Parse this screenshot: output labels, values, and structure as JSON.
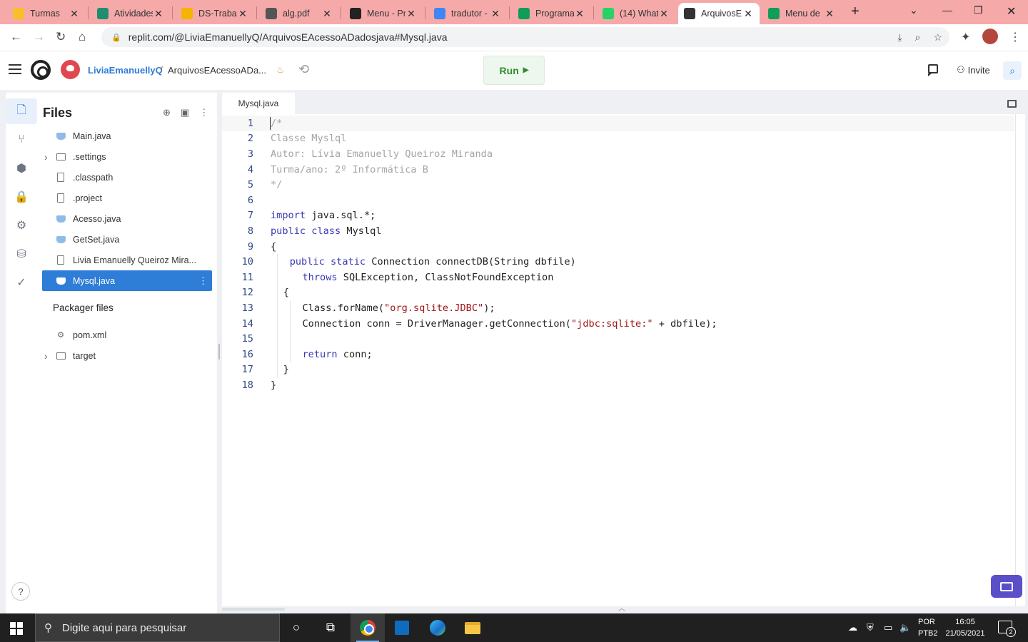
{
  "browser": {
    "tabs": [
      {
        "title": "Turmas",
        "icon": "classroom-icon",
        "color": "#f9bf2b"
      },
      {
        "title": "Atividades",
        "icon": "classroom-assignment-icon",
        "color": "#1e8e6e"
      },
      {
        "title": "DS-Trabal",
        "icon": "drive-icon",
        "color": "#f4b400"
      },
      {
        "title": "alg.pdf",
        "icon": "pdf-icon",
        "color": "#555555"
      },
      {
        "title": "Menu - Pr",
        "icon": "github-icon",
        "color": "#222222"
      },
      {
        "title": "tradutor -",
        "icon": "google-icon",
        "color": "#4285f4"
      },
      {
        "title": "Programa",
        "icon": "drive-icon",
        "color": "#0f9d58"
      },
      {
        "title": "(14) What",
        "icon": "whatsapp-icon",
        "color": "#25d366"
      },
      {
        "title": "ArquivosE",
        "icon": "replit-icon",
        "color": "#333333",
        "active": true
      },
      {
        "title": "Menu de",
        "icon": "sheets-icon",
        "color": "#0f9d58"
      }
    ],
    "url": "replit.com/@LiviaEmanuellyQ/ArquivosEAcessoADadosjava#Mysql.java"
  },
  "header": {
    "username": "LiviaEmanuellyQ",
    "separator": "/",
    "repl_name": "ArquivosEAcessoADa...",
    "run_label": "Run",
    "invite_label": "Invite"
  },
  "sidebar": {
    "title": "Files",
    "files": [
      {
        "name": "Main.java",
        "type": "java",
        "folder": false
      },
      {
        "name": ".settings",
        "type": "folder",
        "folder": true
      },
      {
        "name": ".classpath",
        "type": "file",
        "folder": false
      },
      {
        "name": ".project",
        "type": "file",
        "folder": false
      },
      {
        "name": "Acesso.java",
        "type": "java",
        "folder": false
      },
      {
        "name": "GetSet.java",
        "type": "java",
        "folder": false
      },
      {
        "name": "Livia Emanuelly Queiroz Mira...",
        "type": "file",
        "folder": false
      },
      {
        "name": "Mysql.java",
        "type": "java",
        "folder": false,
        "selected": true
      }
    ],
    "packager_title": "Packager files",
    "packager_files": [
      {
        "name": "pom.xml",
        "type": "xml",
        "folder": false
      },
      {
        "name": "target",
        "type": "folder",
        "folder": true
      }
    ],
    "help_label": "?"
  },
  "editor": {
    "tab_label": "Mysql.java",
    "lines": [
      {
        "n": "1",
        "indent": 0,
        "tokens": [
          {
            "t": "/*",
            "c": "com"
          }
        ]
      },
      {
        "n": "2",
        "indent": 0,
        "tokens": [
          {
            "t": "Classe Myslql",
            "c": "com"
          }
        ]
      },
      {
        "n": "3",
        "indent": 0,
        "tokens": [
          {
            "t": "Autor: Lívia Emanuelly Queiroz Miranda",
            "c": "com"
          }
        ]
      },
      {
        "n": "4",
        "indent": 0,
        "tokens": [
          {
            "t": "Turma/ano: 2º Informática B",
            "c": "com"
          }
        ]
      },
      {
        "n": "5",
        "indent": 0,
        "tokens": [
          {
            "t": "*/",
            "c": "com"
          }
        ]
      },
      {
        "n": "6",
        "indent": 0,
        "tokens": []
      },
      {
        "n": "7",
        "indent": 0,
        "tokens": [
          {
            "t": "import",
            "c": "kw"
          },
          {
            "t": " java.sql.*;",
            "c": ""
          }
        ]
      },
      {
        "n": "8",
        "indent": 0,
        "tokens": [
          {
            "t": "public",
            "c": "kw"
          },
          {
            "t": " ",
            "c": ""
          },
          {
            "t": "class",
            "c": "kw"
          },
          {
            "t": " Myslql",
            "c": ""
          }
        ]
      },
      {
        "n": "9",
        "indent": 0,
        "tokens": [
          {
            "t": "{",
            "c": ""
          }
        ]
      },
      {
        "n": "10",
        "indent": 3,
        "tokens": [
          {
            "t": "public",
            "c": "kw"
          },
          {
            "t": " ",
            "c": ""
          },
          {
            "t": "static",
            "c": "kw"
          },
          {
            "t": " Connection connectDB(String dbfile)",
            "c": ""
          }
        ]
      },
      {
        "n": "11",
        "indent": 5,
        "tokens": [
          {
            "t": "throws",
            "c": "kw"
          },
          {
            "t": " SQLException, ClassNotFoundException",
            "c": ""
          }
        ]
      },
      {
        "n": "12",
        "indent": 2,
        "tokens": [
          {
            "t": "{",
            "c": ""
          }
        ]
      },
      {
        "n": "13",
        "indent": 5,
        "tokens": [
          {
            "t": "Class.forName(",
            "c": ""
          },
          {
            "t": "\"org.sqlite.JDBC\"",
            "c": "str"
          },
          {
            "t": ");",
            "c": ""
          }
        ]
      },
      {
        "n": "14",
        "indent": 5,
        "tokens": [
          {
            "t": "Connection conn = DriverManager.getConnection(",
            "c": ""
          },
          {
            "t": "\"jdbc:sqlite:\"",
            "c": "str"
          },
          {
            "t": " + dbfile);",
            "c": ""
          }
        ]
      },
      {
        "n": "15",
        "indent": 5,
        "tokens": []
      },
      {
        "n": "16",
        "indent": 5,
        "tokens": [
          {
            "t": "return",
            "c": "kw"
          },
          {
            "t": " conn;",
            "c": ""
          }
        ]
      },
      {
        "n": "17",
        "indent": 2,
        "tokens": [
          {
            "t": "}",
            "c": ""
          }
        ]
      },
      {
        "n": "18",
        "indent": 0,
        "tokens": [
          {
            "t": "}",
            "c": ""
          }
        ]
      }
    ]
  },
  "taskbar": {
    "search_placeholder": "Digite aqui para pesquisar",
    "lang_top": "POR",
    "lang_bottom": "PTB2",
    "time": "16:05",
    "date": "21/05/2021",
    "notification_count": "2"
  },
  "colors": {
    "accent": "#2e7dd7",
    "run_green": "#2e8a2e",
    "tabstrip": "#f6a9a9",
    "keyword": "#3a3ab5",
    "string": "#a31515",
    "comment": "#a5a5a5"
  }
}
